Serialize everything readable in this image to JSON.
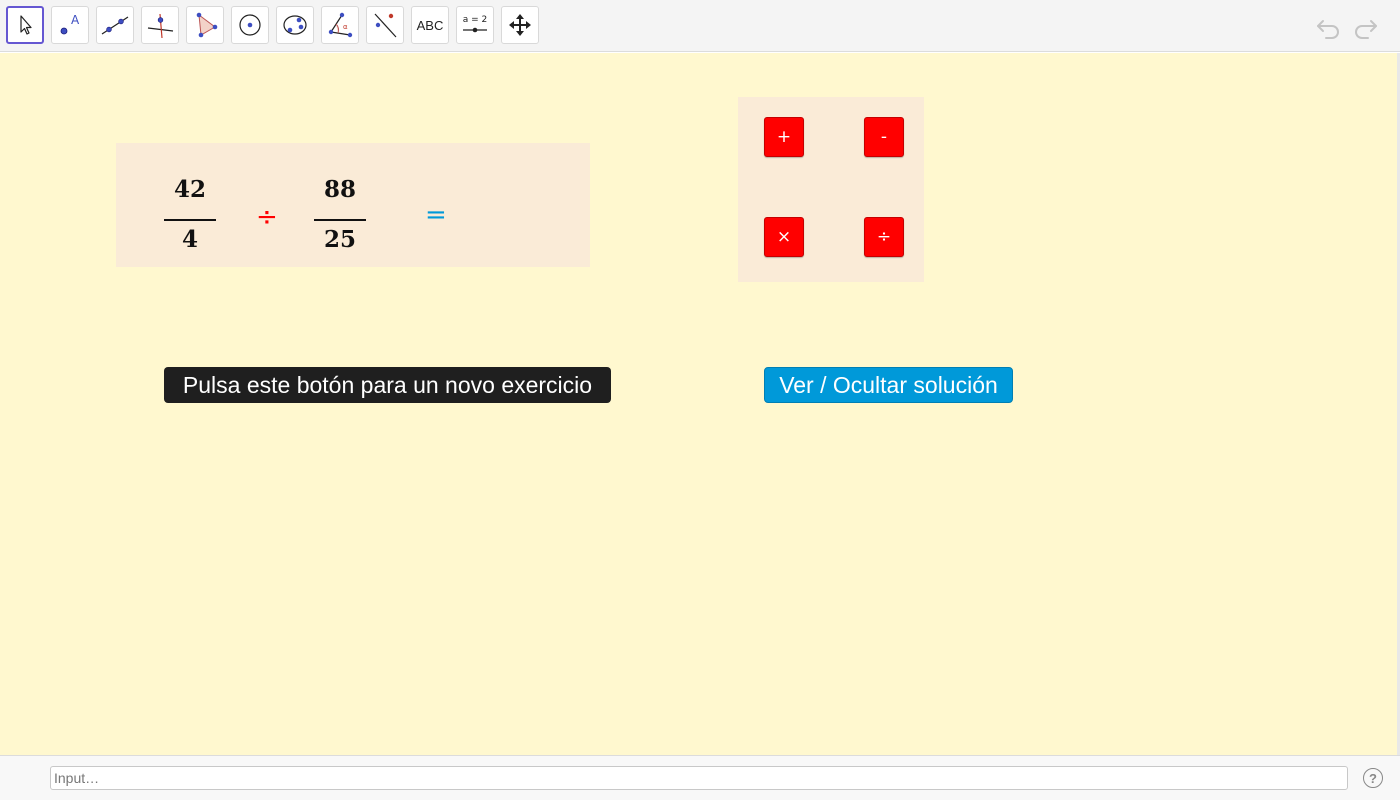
{
  "toolbar": {
    "tools": [
      {
        "name": "move-tool-icon",
        "selected": true
      },
      {
        "name": "point-tool-icon"
      },
      {
        "name": "line-tool-icon"
      },
      {
        "name": "perpendicular-line-tool-icon"
      },
      {
        "name": "polygon-tool-icon"
      },
      {
        "name": "circle-center-point-tool-icon"
      },
      {
        "name": "ellipse-tool-icon"
      },
      {
        "name": "angle-tool-icon"
      },
      {
        "name": "reflect-line-tool-icon"
      },
      {
        "name": "text-tool-icon",
        "label": "ABC"
      },
      {
        "name": "slider-tool-icon",
        "label": "a = 2"
      },
      {
        "name": "move-graphics-view-tool-icon"
      }
    ],
    "undo_icon": "undo-icon",
    "redo_icon": "redo-icon"
  },
  "expression": {
    "fraction1": {
      "numerator": "42",
      "denominator": "4"
    },
    "operator": "÷",
    "fraction2": {
      "numerator": "88",
      "denominator": "25"
    },
    "equals": "="
  },
  "operations": {
    "add": "+",
    "subtract": "-",
    "multiply": "×",
    "divide": "÷"
  },
  "buttons": {
    "new_exercise": "Pulsa este botón para un novo exercicio",
    "toggle_solution": "Ver / Ocultar solución"
  },
  "input_bar": {
    "placeholder": "Input…",
    "help_icon": "help-icon",
    "help_glyph": "?"
  },
  "colors": {
    "canvas_bg": "#fff8cf",
    "panel_bg": "#faebd7",
    "operator_red": "#ff0000",
    "equals_blue": "#0099d9",
    "solution_button": "#0099d9",
    "new_button": "#1f1f1f",
    "selected_tool_border": "#6557d2"
  }
}
